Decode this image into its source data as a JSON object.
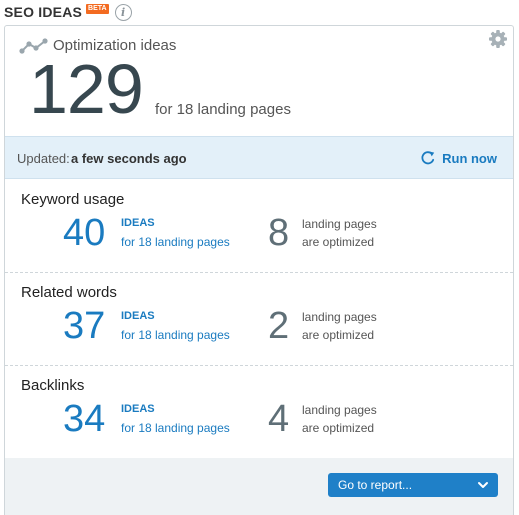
{
  "header": {
    "title": "SEO IDEAS",
    "badge": "BETA"
  },
  "summary": {
    "title": "Optimization ideas",
    "count": "129",
    "subtitle": "for 18 landing pages"
  },
  "status": {
    "updated_label": "Updated:",
    "updated_value": "a few seconds ago",
    "run_label": "Run now"
  },
  "sections": [
    {
      "title": "Keyword usage",
      "ideas_count": "40",
      "ideas_label": "IDEAS",
      "ideas_for": "for 18 landing pages",
      "optimized_count": "8",
      "optimized_line1": "landing pages",
      "optimized_line2": "are optimized"
    },
    {
      "title": "Related words",
      "ideas_count": "37",
      "ideas_label": "IDEAS",
      "ideas_for": "for 18 landing pages",
      "optimized_count": "2",
      "optimized_line1": "landing pages",
      "optimized_line2": "are optimized"
    },
    {
      "title": "Backlinks",
      "ideas_count": "34",
      "ideas_label": "IDEAS",
      "ideas_for": "for 18 landing pages",
      "optimized_count": "4",
      "optimized_line1": "landing pages",
      "optimized_line2": "are optimized"
    }
  ],
  "footer": {
    "report_label": "Go to report..."
  },
  "colors": {
    "accent": "#1a7bc0",
    "badge": "#f36b21",
    "status_bg": "#e3f0f9",
    "button": "#1f80c8"
  },
  "icons": {
    "info": "info-icon",
    "settings": "gear-icon",
    "refresh": "refresh-icon",
    "trend": "trend-icon",
    "dropdown": "chevron-down-icon"
  }
}
